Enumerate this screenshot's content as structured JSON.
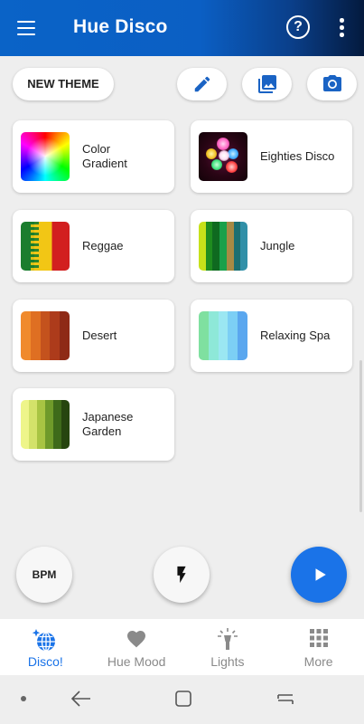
{
  "app": {
    "title": "Hue Disco"
  },
  "actions": {
    "new_theme_label": "NEW THEME"
  },
  "themes": [
    {
      "name": "Color Gradient",
      "label": "Color\nGradient",
      "swatch": "gradient-wheel"
    },
    {
      "name": "Eighties Disco",
      "label": "Eighties Disco",
      "swatch": "disco-image"
    },
    {
      "name": "Reggae",
      "label": "Reggae",
      "swatch": "reggae-image"
    },
    {
      "name": "Jungle",
      "label": "Jungle",
      "colors": [
        "#c6e11a",
        "#1f8c1f",
        "#0f6a20",
        "#1aa04a",
        "#a78a44",
        "#1b6f72",
        "#3190a8"
      ]
    },
    {
      "name": "Desert",
      "label": "Desert",
      "colors": [
        "#f08a2c",
        "#df6f22",
        "#c4521d",
        "#ad3b1b",
        "#8e2a16"
      ]
    },
    {
      "name": "Relaxing Spa",
      "label": "Relaxing Spa",
      "colors": [
        "#7fe0a0",
        "#8ee8d8",
        "#9be7f2",
        "#7ccff5",
        "#5aa7ef"
      ]
    },
    {
      "name": "Japanese Garden",
      "label": "Japanese\nGarden",
      "colors": [
        "#eef58a",
        "#d3e26a",
        "#a8c443",
        "#6f9a2a",
        "#3e6a1a",
        "#26450f"
      ]
    }
  ],
  "fabs": {
    "bpm_label": "BPM"
  },
  "bottom_nav": [
    {
      "label": "Disco!",
      "icon": "globe-sparkle-icon",
      "active": true
    },
    {
      "label": "Hue Mood",
      "icon": "heart-icon",
      "active": false
    },
    {
      "label": "Lights",
      "icon": "lamp-icon",
      "active": false
    },
    {
      "label": "More",
      "icon": "grid-icon",
      "active": false
    }
  ],
  "colors": {
    "accent": "#1a73e8",
    "appbar_start": "#0a63c7",
    "appbar_end": "#041a3e",
    "inactive": "#8a8a8a"
  }
}
